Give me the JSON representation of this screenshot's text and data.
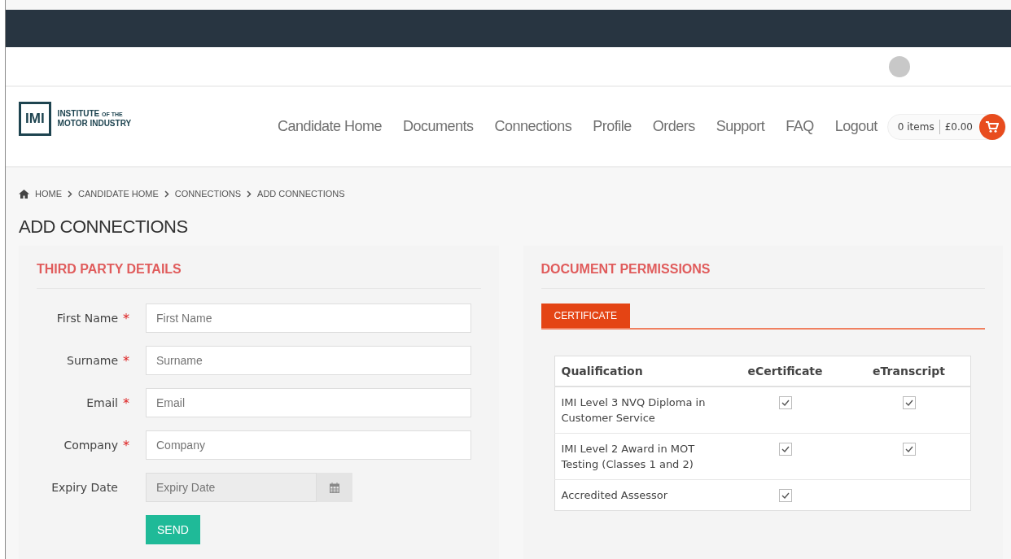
{
  "logo": {
    "mark": "IMI",
    "line1": "INSTITUTE",
    "line1_small": "OF THE",
    "line2": "MOTOR INDUSTRY"
  },
  "nav": [
    "Candidate Home",
    "Documents",
    "Connections",
    "Profile",
    "Orders",
    "Support",
    "FAQ",
    "Logout"
  ],
  "cart": {
    "items": "0 items",
    "total": "£0.00"
  },
  "breadcrumb": [
    "HOME",
    "CANDIDATE HOME",
    "CONNECTIONS",
    "ADD CONNECTIONS"
  ],
  "page_title": "ADD CONNECTIONS",
  "third_party": {
    "heading": "THIRD PARTY DETAILS",
    "fields": [
      {
        "label": "First Name",
        "required_mark": "*",
        "placeholder": "First Name",
        "kind": "text"
      },
      {
        "label": "Surname",
        "required_mark": "*",
        "placeholder": "Surname",
        "kind": "text"
      },
      {
        "label": "Email",
        "required_mark": "*",
        "placeholder": "Email",
        "kind": "text"
      },
      {
        "label": "Company",
        "required_mark": "*",
        "placeholder": "Company",
        "kind": "text"
      },
      {
        "label": "Expiry Date",
        "placeholder": "Expiry Date",
        "kind": "date"
      }
    ],
    "submit": "SEND"
  },
  "permissions": {
    "heading": "DOCUMENT PERMISSIONS",
    "tabs": [
      {
        "label": "CERTIFICATE",
        "selected": true
      }
    ],
    "columns": [
      "Qualification",
      "eCertificate",
      "eTranscript"
    ],
    "rows": [
      {
        "qualification": "IMI Level 3 NVQ Diploma in Customer Service",
        "ecertificate": {
          "checked": true
        },
        "etranscript": {
          "checked": true
        }
      },
      {
        "qualification": "IMI Level 2 Award in MOT Testing (Classes 1 and 2)",
        "ecertificate": {
          "checked": true
        },
        "etranscript": {
          "checked": true
        }
      },
      {
        "qualification": "Accredited Assessor",
        "ecertificate": {
          "checked": true
        }
      }
    ]
  }
}
